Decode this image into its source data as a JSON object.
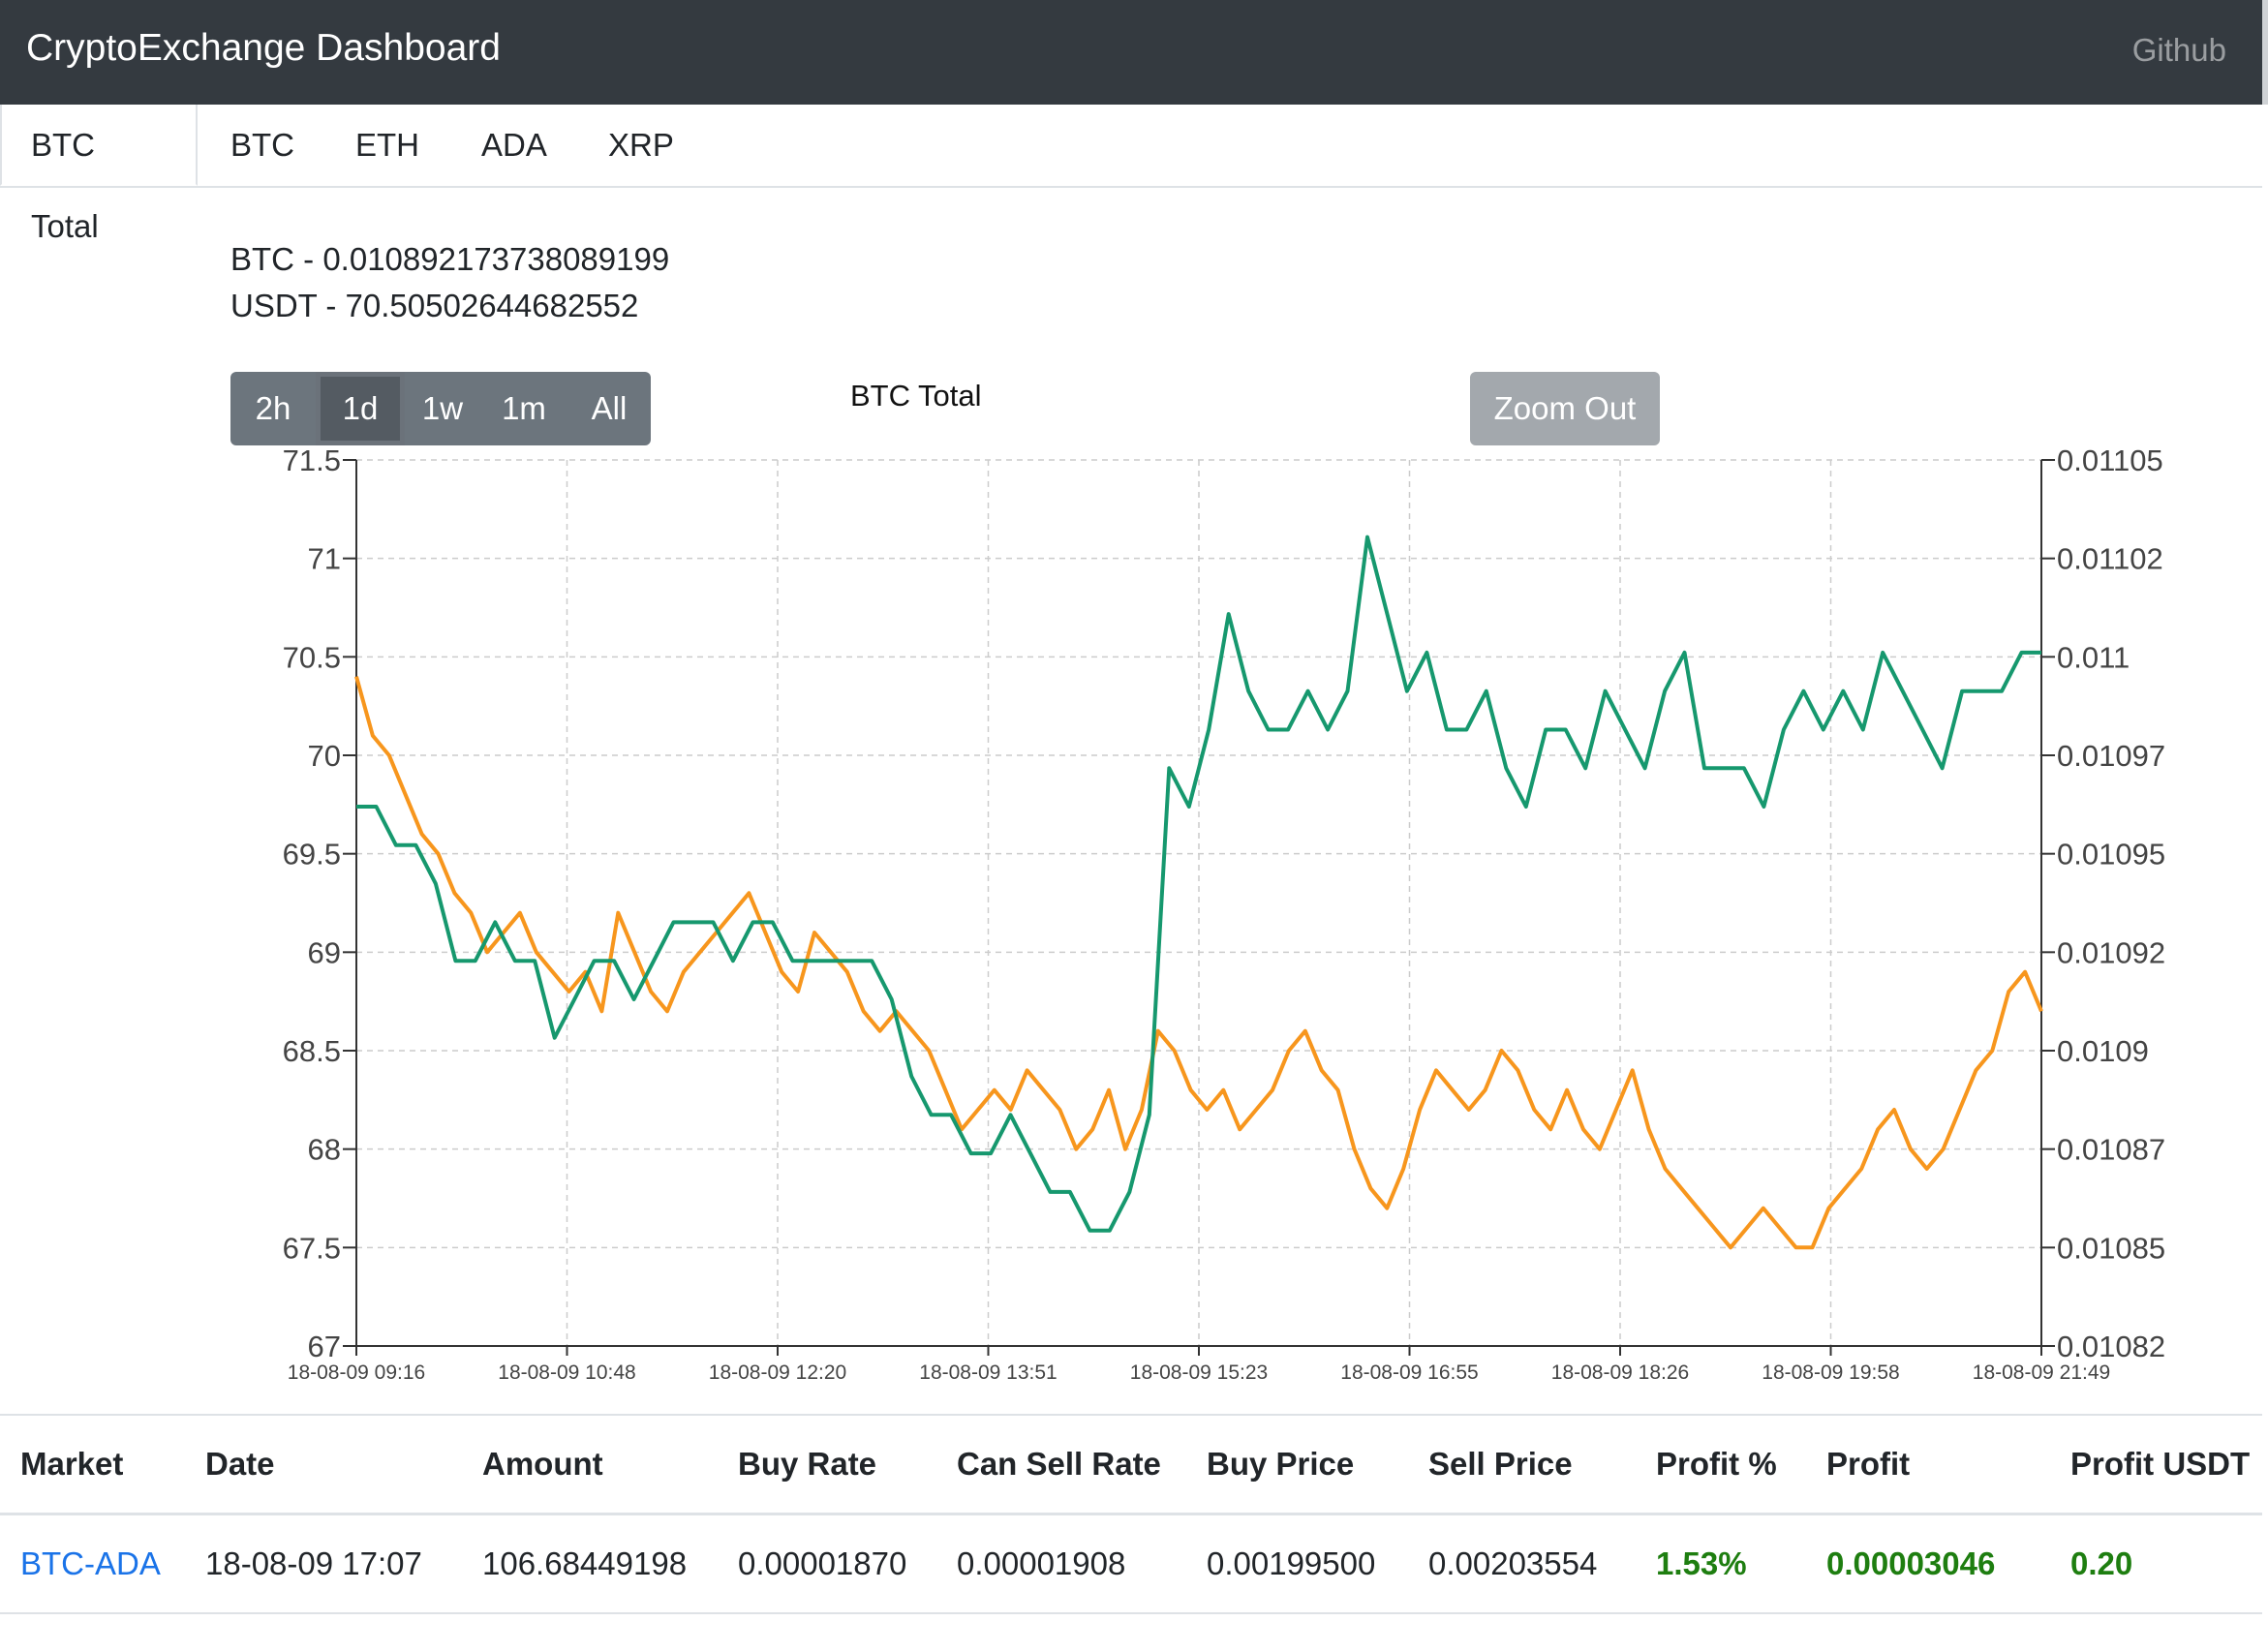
{
  "navbar": {
    "brand": "CryptoExchange Dashboard",
    "github": "Github"
  },
  "tabs": [
    "BTC Total",
    "BTC",
    "ETH",
    "ADA",
    "XRP"
  ],
  "balances": {
    "btc": "BTC - 0.010892173738089199",
    "usdt": "USDT - 70.50502644682552"
  },
  "ranges": [
    "2h",
    "1d",
    "1w",
    "1m",
    "All"
  ],
  "active_range": "1d",
  "zoom_label": "Zoom Out",
  "colors": {
    "usdt_series": "#f7961d",
    "btc_series": "#16986e",
    "nav_bg": "#343a40",
    "profit_green": "#1e7e10"
  },
  "chart_data": {
    "type": "line",
    "title": "BTC Total",
    "x_ticks": [
      "18-08-09 09:16",
      "18-08-09 10:48",
      "18-08-09 12:20",
      "18-08-09 13:51",
      "18-08-09 15:23",
      "18-08-09 16:55",
      "18-08-09 18:26",
      "18-08-09 19:58",
      "18-08-09 21:49"
    ],
    "y_left": {
      "ticks": [
        "67",
        "67.5",
        "68",
        "68.5",
        "69",
        "69.5",
        "70",
        "70.5",
        "71",
        "71.5"
      ],
      "range": [
        67,
        71.5
      ]
    },
    "y_right": {
      "ticks": [
        "0.01082",
        "0.01085",
        "0.01087",
        "0.0109",
        "0.01092",
        "0.01095",
        "0.01097",
        "0.011",
        "0.01102",
        "0.01105"
      ],
      "range": [
        0.01082,
        0.01105
      ]
    },
    "grid": true,
    "series": [
      {
        "axis": "left",
        "values": [
          70.4,
          70.1,
          70.0,
          69.8,
          69.6,
          69.5,
          69.3,
          69.2,
          69.0,
          69.1,
          69.2,
          69.0,
          68.9,
          68.8,
          68.9,
          68.7,
          69.2,
          69.0,
          68.8,
          68.7,
          68.9,
          69.0,
          69.1,
          69.2,
          69.3,
          69.1,
          68.9,
          68.8,
          69.1,
          69.0,
          68.9,
          68.7,
          68.6,
          68.7,
          68.6,
          68.5,
          68.3,
          68.1,
          68.2,
          68.3,
          68.2,
          68.4,
          68.3,
          68.2,
          68.0,
          68.1,
          68.3,
          68.0,
          68.2,
          68.6,
          68.5,
          68.3,
          68.2,
          68.3,
          68.1,
          68.2,
          68.3,
          68.5,
          68.6,
          68.4,
          68.3,
          68.0,
          67.8,
          67.7,
          67.9,
          68.2,
          68.4,
          68.3,
          68.2,
          68.3,
          68.5,
          68.4,
          68.2,
          68.1,
          68.3,
          68.1,
          68.0,
          68.2,
          68.4,
          68.1,
          67.9,
          67.8,
          67.7,
          67.6,
          67.5,
          67.6,
          67.7,
          67.6,
          67.5,
          67.5,
          67.7,
          67.8,
          67.9,
          68.1,
          68.2,
          68.0,
          67.9,
          68.0,
          68.2,
          68.4,
          68.5,
          68.8,
          68.9,
          68.7
        ]
      },
      {
        "axis": "right",
        "values": [
          0.01096,
          0.01096,
          0.01095,
          0.01095,
          0.01094,
          0.01092,
          0.01092,
          0.01093,
          0.01092,
          0.01092,
          0.0109,
          0.01091,
          0.01092,
          0.01092,
          0.01091,
          0.01092,
          0.01093,
          0.01093,
          0.01093,
          0.01092,
          0.01093,
          0.01093,
          0.01092,
          0.01092,
          0.01092,
          0.01092,
          0.01092,
          0.01091,
          0.01089,
          0.01088,
          0.01088,
          0.01087,
          0.01087,
          0.01088,
          0.01087,
          0.01086,
          0.01086,
          0.01085,
          0.01085,
          0.01086,
          0.01088,
          0.01097,
          0.01096,
          0.01098,
          0.01101,
          0.01099,
          0.01098,
          0.01098,
          0.01099,
          0.01098,
          0.01099,
          0.01103,
          0.01101,
          0.01099,
          0.011,
          0.01098,
          0.01098,
          0.01099,
          0.01097,
          0.01096,
          0.01098,
          0.01098,
          0.01097,
          0.01099,
          0.01098,
          0.01097,
          0.01099,
          0.011,
          0.01097,
          0.01097,
          0.01097,
          0.01096,
          0.01098,
          0.01099,
          0.01098,
          0.01099,
          0.01098,
          0.011,
          0.01099,
          0.01098,
          0.01097,
          0.01099,
          0.01099,
          0.01099,
          0.011,
          0.011
        ]
      }
    ]
  },
  "table": {
    "headers": [
      "Market",
      "Date",
      "Amount",
      "Buy Rate",
      "Can Sell Rate",
      "Buy Price",
      "Sell Price",
      "Profit %",
      "Profit",
      "Profit USDT"
    ],
    "rows": [
      [
        "BTC-ADA",
        "18-08-09 17:07",
        "106.68449198",
        "0.00001870",
        "0.00001908",
        "0.00199500",
        "0.00203554",
        "1.53%",
        "0.00003046",
        "0.20"
      ]
    ]
  }
}
